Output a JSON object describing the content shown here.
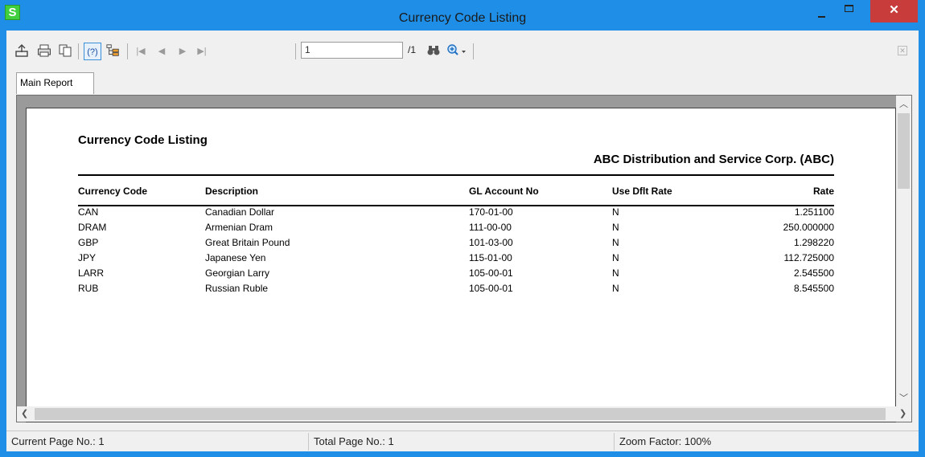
{
  "window": {
    "title": "Currency Code Listing",
    "app_icon": "S",
    "close_glyph": "✕"
  },
  "toolbar": {
    "page_input": "1",
    "page_total": "/1"
  },
  "tabs": [
    {
      "label": "Main Report"
    }
  ],
  "report": {
    "title": "Currency Code Listing",
    "company": "ABC Distribution and Service Corp. (ABC)",
    "columns": [
      "Currency Code",
      "Description",
      "GL Account No",
      "Use Dflt Rate",
      "Rate"
    ],
    "rows": [
      [
        "CAN",
        "Canadian Dollar",
        "170-01-00",
        "N",
        "1.251100"
      ],
      [
        "DRAM",
        "Armenian Dram",
        "111-00-00",
        "N",
        "250.000000"
      ],
      [
        "GBP",
        "Great Britain Pound",
        "101-03-00",
        "N",
        "1.298220"
      ],
      [
        "JPY",
        "Japanese Yen",
        "115-01-00",
        "N",
        "112.725000"
      ],
      [
        "LARR",
        "Georgian Larry",
        "105-00-01",
        "N",
        "2.545500"
      ],
      [
        "RUB",
        "Russian Ruble",
        "105-00-01",
        "N",
        "8.545500"
      ]
    ]
  },
  "status": {
    "current_page": "Current Page No.: 1",
    "total_page": "Total Page No.: 1",
    "zoom": "Zoom Factor: 100%"
  },
  "colors": {
    "title_bar": "#1e8ee6",
    "close_button": "#c83c3c",
    "app_icon": "#3fcf3f"
  }
}
